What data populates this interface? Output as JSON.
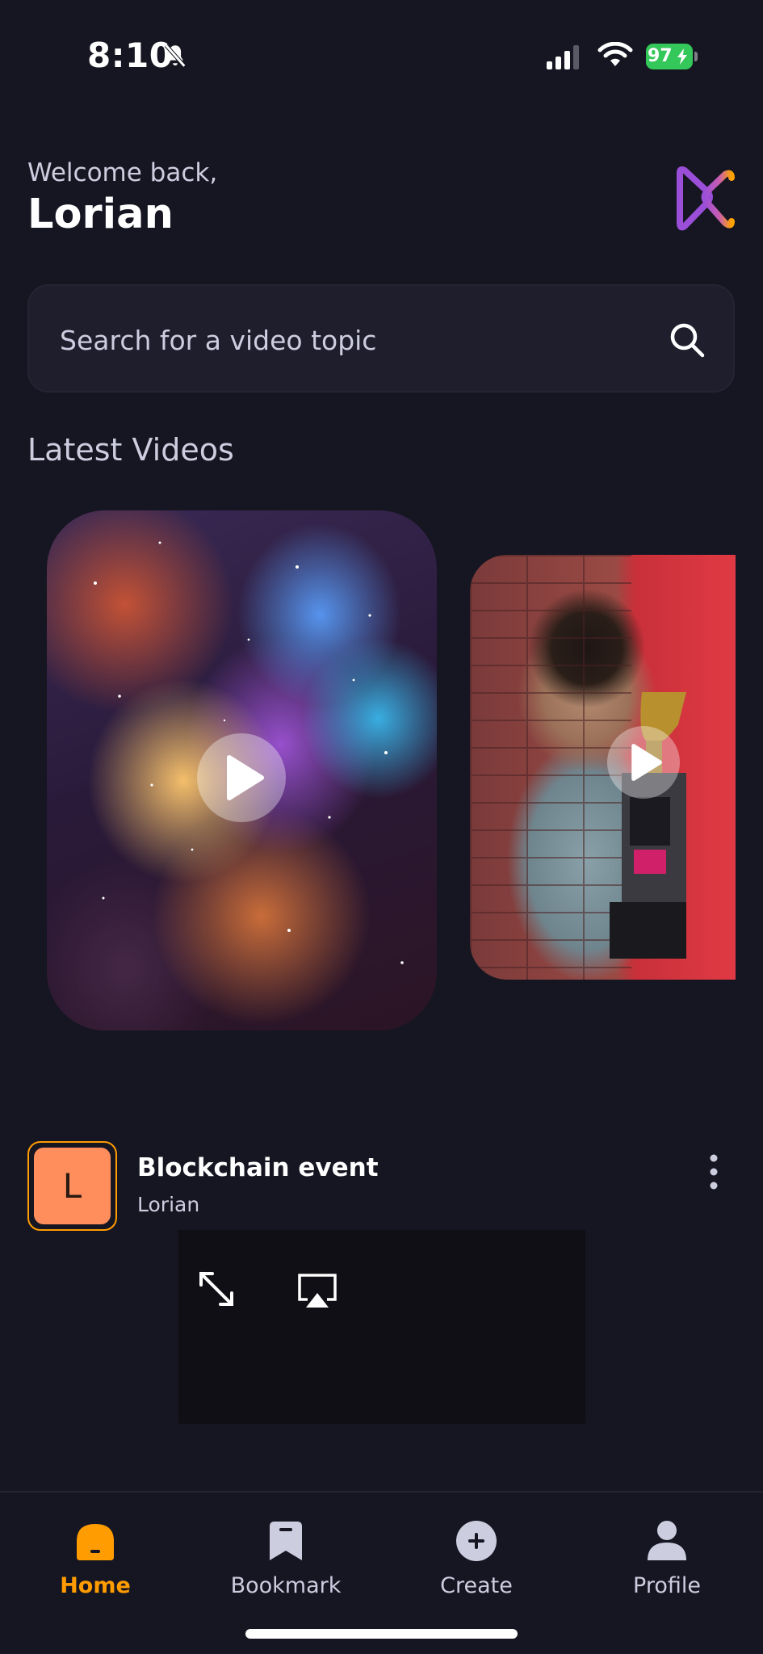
{
  "status_bar": {
    "time": "8:10",
    "battery": "97"
  },
  "header": {
    "greeting": "Welcome back,",
    "username": "Lorian"
  },
  "search": {
    "placeholder": "Search for a video topic"
  },
  "latest": {
    "title": "Latest Videos"
  },
  "post": {
    "avatar_letter": "L",
    "title": "Blockchain event",
    "author": "Lorian"
  },
  "tabs": [
    {
      "label": "Home",
      "icon": "home-icon",
      "active": true
    },
    {
      "label": "Bookmark",
      "icon": "bookmark-icon",
      "active": false
    },
    {
      "label": "Create",
      "icon": "plus-circle-icon",
      "active": false
    },
    {
      "label": "Profile",
      "icon": "profile-icon",
      "active": false
    }
  ],
  "colors": {
    "background": "#161622",
    "accent": "#ff9c01",
    "surface": "#1e1e2d",
    "muted_text": "#cdcde0"
  }
}
